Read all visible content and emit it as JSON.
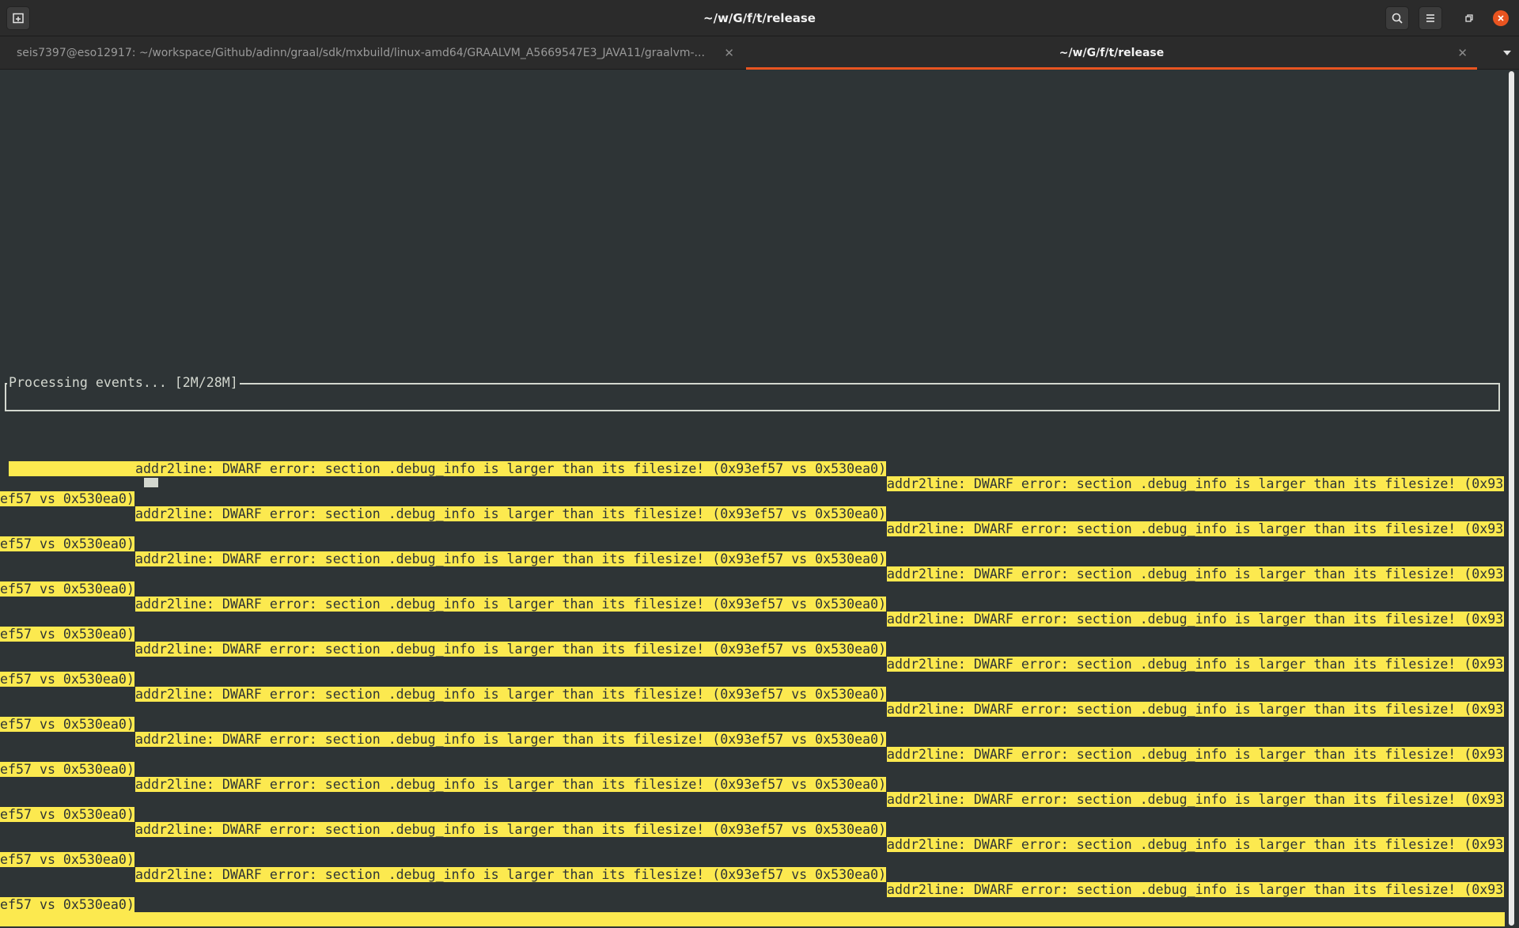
{
  "window": {
    "title": "~/w/G/f/t/release"
  },
  "tabs": [
    {
      "label": "seis7397@eso12917: ~/workspace/Github/adinn/graal/sdk/mxbuild/linux-amd64/GRAALVM_A5669547E3_JAVA11/graalvm-...",
      "active": false
    },
    {
      "label": "~/w/G/f/t/release",
      "active": true
    }
  ],
  "terminal": {
    "progress_title": "Processing events... [2M/28M]",
    "error_line": "addr2line: DWARF error: section .debug_info is larger than its filesize! (0x93ef57 vs 0x530ea0)",
    "error_head": "addr2line: DWARF error: section .debug_info is larger than its filesize! (0x93",
    "error_tail": "ef57 vs 0x530ea0)"
  },
  "colors": {
    "terminal_bg": "#2e3436",
    "highlight": "#fce94f",
    "accent": "#e95420",
    "headerbar": "#2b2b2b"
  },
  "icons": {
    "new_tab": "new-tab-icon",
    "search": "search-icon",
    "menu": "hamburger-menu-icon",
    "restore": "restore-icon",
    "close": "close-icon",
    "tab_close": "tab-close-icon",
    "tab_menu": "chevron-down-icon"
  }
}
